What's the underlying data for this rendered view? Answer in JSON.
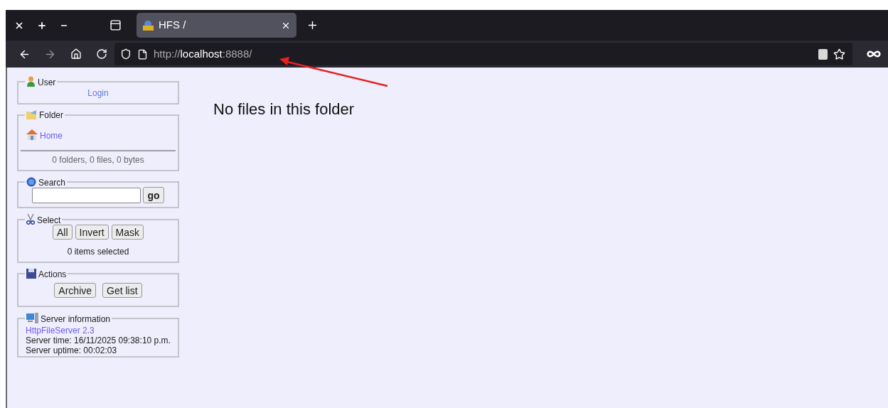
{
  "browser": {
    "tabs": [
      {
        "title": "HFS /",
        "selected": true
      }
    ],
    "address": {
      "scheme": "http://",
      "host": "localhost",
      "rest": ":8888/"
    }
  },
  "sidebar": [
    {
      "kind": "user",
      "title": "User",
      "link": "Login"
    },
    {
      "kind": "folder",
      "title": "Folder",
      "link": "Home",
      "summary": "0 folders, 0 files, 0 bytes"
    },
    {
      "kind": "search",
      "title": "Search",
      "button": "go"
    },
    {
      "kind": "select",
      "title": "Select",
      "buttons": [
        "All",
        "Invert",
        "Mask"
      ],
      "summary": "0 items selected"
    },
    {
      "kind": "actions",
      "title": "Actions",
      "buttons": [
        "Archive",
        "Get list"
      ]
    },
    {
      "kind": "server",
      "title": "Server information",
      "link": "HttpFileServer 2.3",
      "lines": [
        "Server time: 16/11/2025 09:38:10 p.m.",
        "Server uptime: 00:02:03"
      ]
    }
  ],
  "main": {
    "message": "No files in this folder"
  }
}
